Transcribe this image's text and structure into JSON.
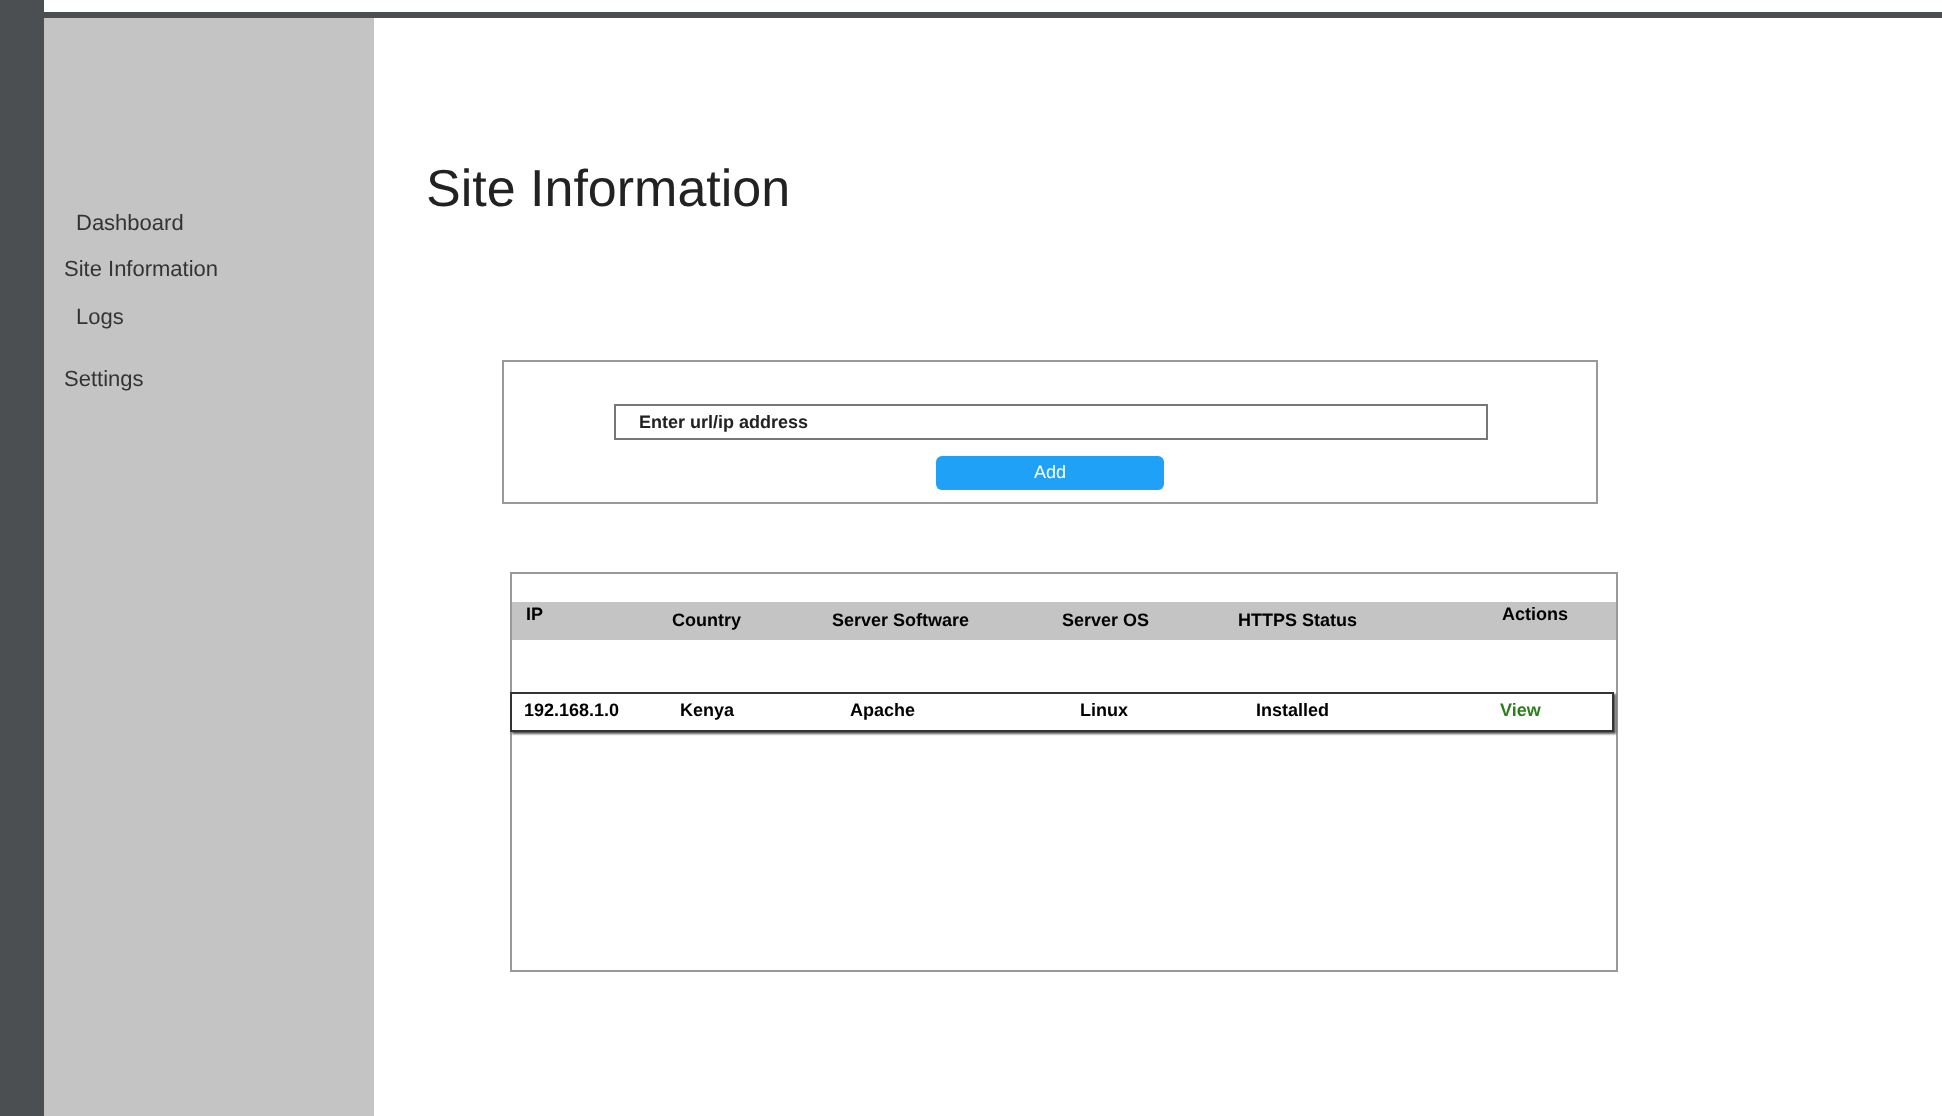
{
  "sidebar": {
    "items": [
      {
        "label": "Dashboard"
      },
      {
        "label": "Site Information"
      },
      {
        "label": "Logs"
      },
      {
        "label": "Settings"
      }
    ]
  },
  "page": {
    "title": "Site Information"
  },
  "form": {
    "placeholder": "Enter url/ip address",
    "button": "Add"
  },
  "table": {
    "columns": [
      "IP",
      "Country",
      "Server Software",
      "Server OS",
      "HTTPS Status",
      "Actions"
    ],
    "rows": [
      {
        "cells": [
          "192.168.1.0",
          "Kenya",
          "Apache",
          "Linux",
          "Installed"
        ],
        "action": "View"
      }
    ]
  }
}
